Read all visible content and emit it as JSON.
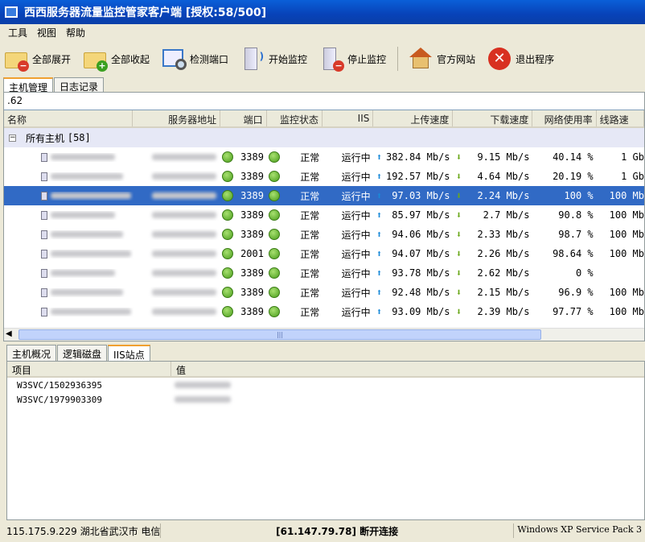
{
  "window": {
    "title": "西西服务器流量监控管家客户端 [授权:58/500]"
  },
  "menu": [
    "工具",
    "视图",
    "帮助"
  ],
  "toolbar": [
    {
      "label": "全部展开",
      "icon": "folder-collapse-icon"
    },
    {
      "label": "全部收起",
      "icon": "folder-expand-icon"
    },
    {
      "label": "检测端口",
      "icon": "port-check-icon"
    },
    {
      "label": "开始监控",
      "icon": "start-monitor-icon"
    },
    {
      "label": "停止监控",
      "icon": "stop-monitor-icon"
    },
    {
      "label": "官方网站",
      "icon": "home-icon"
    },
    {
      "label": "退出程序",
      "icon": "exit-icon"
    }
  ],
  "tabs": [
    "主机管理",
    "日志记录"
  ],
  "search": {
    "value": ".62"
  },
  "columns": [
    "名称",
    "服务器地址",
    "端口",
    "监控状态",
    "IIS",
    "上传速度",
    "下载速度",
    "网络使用率",
    "线路速"
  ],
  "group": {
    "label": "所有主机",
    "count": "[58]"
  },
  "rows": [
    {
      "port": "3389",
      "status": "正常",
      "iis": "运行中",
      "up": "382.84 Mb/s",
      "down": "9.15 Mb/s",
      "usage": "40.14 %",
      "line": "1 Gb"
    },
    {
      "port": "3389",
      "status": "正常",
      "iis": "运行中",
      "up": "192.57 Mb/s",
      "down": "4.64 Mb/s",
      "usage": "20.19 %",
      "line": "1 Gb"
    },
    {
      "port": "3389",
      "status": "正常",
      "iis": "运行中",
      "up": "97.03 Mb/s",
      "down": "2.24 Mb/s",
      "usage": "100 %",
      "line": "100 Mb"
    },
    {
      "port": "3389",
      "status": "正常",
      "iis": "运行中",
      "up": "85.97 Mb/s",
      "down": "2.7 Mb/s",
      "usage": "90.8 %",
      "line": "100 Mb"
    },
    {
      "port": "3389",
      "status": "正常",
      "iis": "运行中",
      "up": "94.06 Mb/s",
      "down": "2.33 Mb/s",
      "usage": "98.7 %",
      "line": "100 Mb"
    },
    {
      "port": "2001",
      "status": "正常",
      "iis": "运行中",
      "up": "94.07 Mb/s",
      "down": "2.26 Mb/s",
      "usage": "98.64 %",
      "line": "100 Mb"
    },
    {
      "port": "3389",
      "status": "正常",
      "iis": "运行中",
      "up": "93.78 Mb/s",
      "down": "2.62 Mb/s",
      "usage": "0 %",
      "line": ""
    },
    {
      "port": "3389",
      "status": "正常",
      "iis": "运行中",
      "up": "92.48 Mb/s",
      "down": "2.15 Mb/s",
      "usage": "96.9 %",
      "line": "100 Mb"
    },
    {
      "port": "3389",
      "status": "正常",
      "iis": "运行中",
      "up": "93.09 Mb/s",
      "down": "2.39 Mb/s",
      "usage": "97.77 %",
      "line": "100 Mb"
    }
  ],
  "bottom_tabs": [
    "主机概况",
    "逻辑磁盘",
    "IIS站点"
  ],
  "details": {
    "columns": [
      "项目",
      "值"
    ],
    "rows": [
      "W3SVC/1502936395",
      "W3SVC/1979903309"
    ]
  },
  "statusbar": {
    "left": "115.175.9.229 湖北省武汉市 电信",
    "center": "[61.147.79.78] 断开连接",
    "right": "Windows XP Service Pack 3"
  }
}
